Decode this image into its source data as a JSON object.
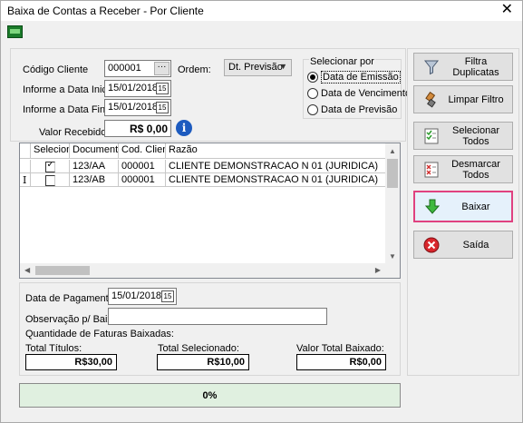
{
  "window": {
    "title": "Baixa de Contas a Receber - Por Cliente",
    "close_glyph": "✕"
  },
  "filters": {
    "codigo_cliente_label": "Código Cliente",
    "codigo_cliente_value": "000001",
    "lookup_glyph": "···",
    "ordem_label": "Ordem:",
    "ordem_value": "Dt. Previsão",
    "data_inicial_label": "Informe a Data Inicial",
    "data_inicial_value": "15/01/2018",
    "data_final_label": "Informe a Data Final",
    "data_final_value": "15/01/2018",
    "valor_recebido_label": "Valor Recebido:",
    "valor_recebido_value": "R$ 0,00",
    "info_glyph": "i",
    "cal_glyph": "15"
  },
  "selecionar_por": {
    "legend": "Selecionar por",
    "options": [
      "Data de Emissão",
      "Data de Vencimento",
      "Data de Previsão"
    ],
    "selected_index": 0
  },
  "grid": {
    "columns": [
      "Seleciona",
      "Documento",
      "Cod. Cliente",
      "Razão"
    ],
    "rows": [
      {
        "selected": true,
        "documento": "123/AA",
        "cod_cliente": "000001",
        "razao": "CLIENTE DEMONSTRACAO N 01   (JURIDICA)"
      },
      {
        "selected": false,
        "documento": "123/AB",
        "cod_cliente": "000001",
        "razao": "CLIENTE DEMONSTRACAO N 01   (JURIDICA)",
        "marker": "I"
      }
    ]
  },
  "payment": {
    "data_pagamento_label": "Data de Pagamento",
    "data_pagamento_value": "15/01/2018",
    "observacao_label": "Observação p/ Baixa",
    "observacao_value": "",
    "quantidade_label": "Quantidade de Faturas Baixadas:",
    "total_titulos_label": "Total Títulos:",
    "total_titulos_value": "R$30,00",
    "total_selecionado_label": "Total Selecionado:",
    "total_selecionado_value": "R$10,00",
    "valor_total_label": "Valor Total Baixado:",
    "valor_total_value": "R$0,00"
  },
  "progress": {
    "label": "0%",
    "value": 0
  },
  "buttons": {
    "filtra": "Filtra Duplicatas",
    "limpar": "Limpar Filtro",
    "selecionar": "Selecionar Todos",
    "desmarcar": "Desmarcar Todos",
    "baixar": "Baixar",
    "saida": "Saída"
  },
  "colors": {
    "progress_bg": "#e0f0e0",
    "active_border": "#e0417f",
    "info_blue": "#1d5bbf"
  }
}
